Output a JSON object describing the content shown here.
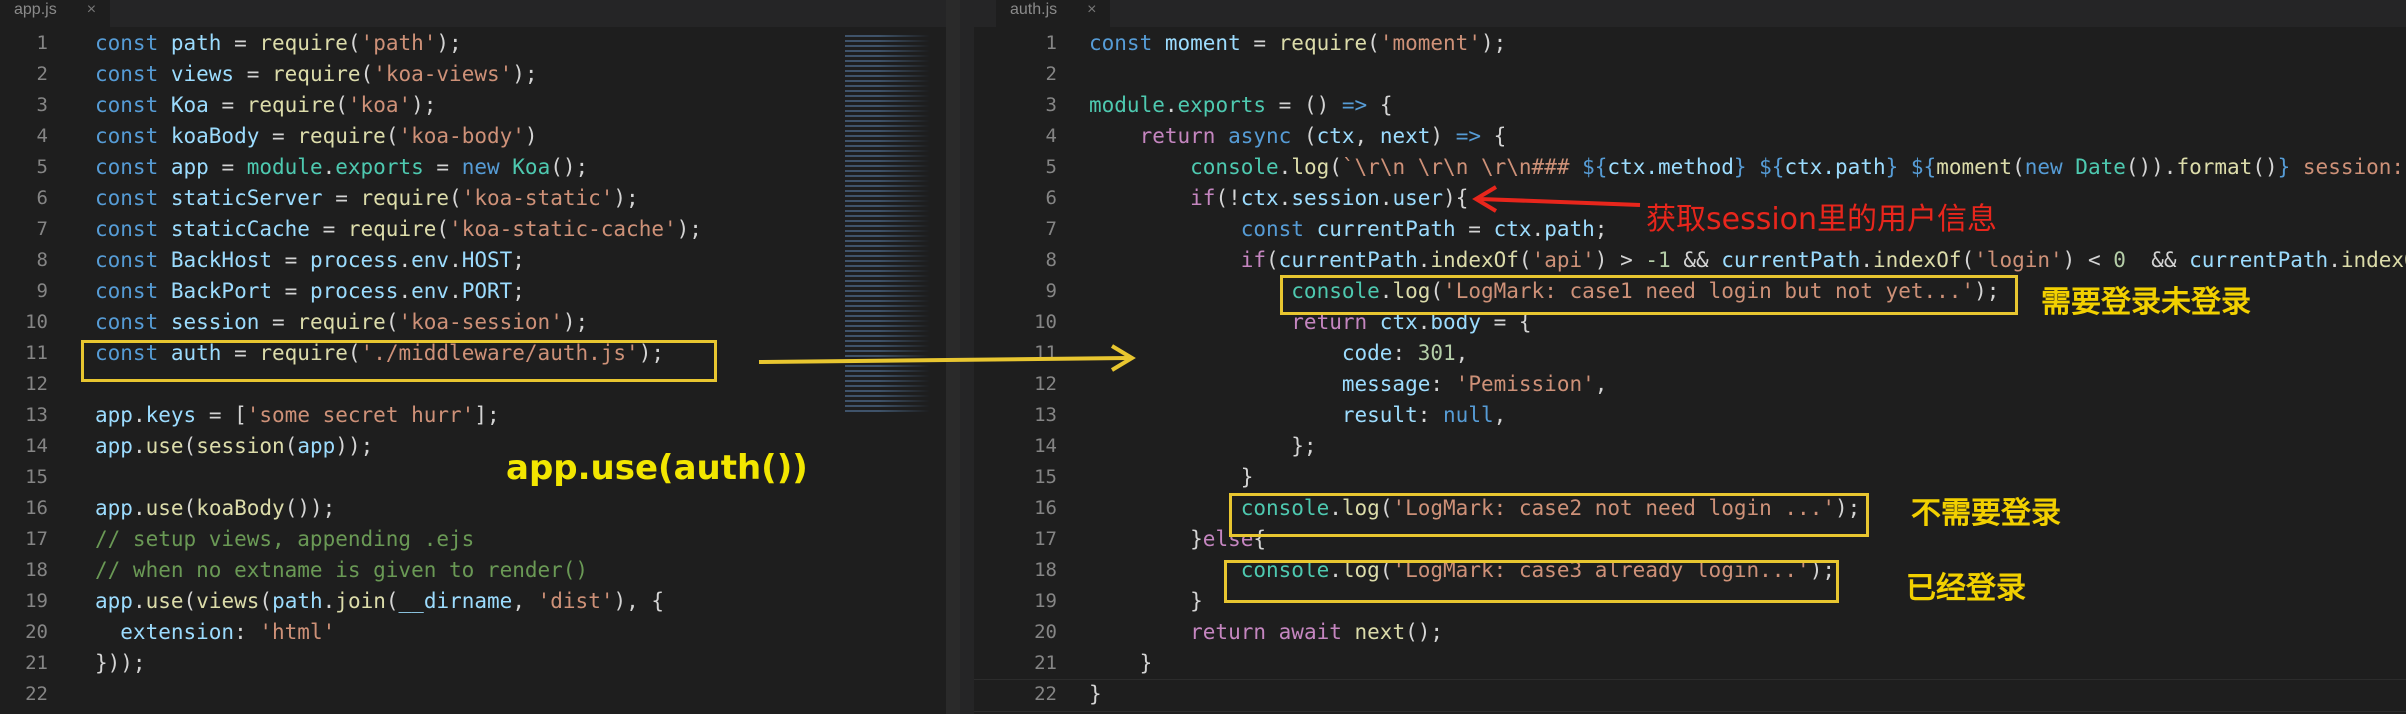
{
  "left": {
    "tab_label": "app.js",
    "tab_close": "×",
    "lines": [
      [
        [
          "const ",
          "k"
        ],
        [
          "path",
          "v"
        ],
        [
          " = ",
          "o"
        ],
        [
          "require",
          "f"
        ],
        [
          "(",
          "o"
        ],
        [
          "'path'",
          "s"
        ],
        [
          ");",
          "o"
        ]
      ],
      [
        [
          "const ",
          "k"
        ],
        [
          "views",
          "v"
        ],
        [
          " = ",
          "o"
        ],
        [
          "require",
          "f"
        ],
        [
          "(",
          "o"
        ],
        [
          "'koa-views'",
          "s"
        ],
        [
          ");",
          "o"
        ]
      ],
      [
        [
          "const ",
          "k"
        ],
        [
          "Koa",
          "v"
        ],
        [
          " = ",
          "o"
        ],
        [
          "require",
          "f"
        ],
        [
          "(",
          "o"
        ],
        [
          "'koa'",
          "s"
        ],
        [
          ");",
          "o"
        ]
      ],
      [
        [
          "const ",
          "k"
        ],
        [
          "koaBody",
          "v"
        ],
        [
          " = ",
          "o"
        ],
        [
          "require",
          "f"
        ],
        [
          "(",
          "o"
        ],
        [
          "'koa-body'",
          "s"
        ],
        [
          ")",
          "o"
        ]
      ],
      [
        [
          "const ",
          "k"
        ],
        [
          "app",
          "v"
        ],
        [
          " = ",
          "o"
        ],
        [
          "module",
          "m"
        ],
        [
          ".",
          "o"
        ],
        [
          "exports",
          "m"
        ],
        [
          " = ",
          "o"
        ],
        [
          "new ",
          "k"
        ],
        [
          "Koa",
          "m"
        ],
        [
          "();",
          "o"
        ]
      ],
      [
        [
          "const ",
          "k"
        ],
        [
          "staticServer",
          "v"
        ],
        [
          " = ",
          "o"
        ],
        [
          "require",
          "f"
        ],
        [
          "(",
          "o"
        ],
        [
          "'koa-static'",
          "s"
        ],
        [
          ");",
          "o"
        ]
      ],
      [
        [
          "const ",
          "k"
        ],
        [
          "staticCache",
          "v"
        ],
        [
          " = ",
          "o"
        ],
        [
          "require",
          "f"
        ],
        [
          "(",
          "o"
        ],
        [
          "'koa-static-cache'",
          "s"
        ],
        [
          ");",
          "o"
        ]
      ],
      [
        [
          "const ",
          "k"
        ],
        [
          "BackHost",
          "v"
        ],
        [
          " = ",
          "o"
        ],
        [
          "process",
          "v"
        ],
        [
          ".",
          "o"
        ],
        [
          "env",
          "v"
        ],
        [
          ".",
          "o"
        ],
        [
          "HOST",
          "v"
        ],
        [
          ";",
          "o"
        ]
      ],
      [
        [
          "const ",
          "k"
        ],
        [
          "BackPort",
          "v"
        ],
        [
          " = ",
          "o"
        ],
        [
          "process",
          "v"
        ],
        [
          ".",
          "o"
        ],
        [
          "env",
          "v"
        ],
        [
          ".",
          "o"
        ],
        [
          "PORT",
          "v"
        ],
        [
          ";",
          "o"
        ]
      ],
      [
        [
          "const ",
          "k"
        ],
        [
          "session",
          "v"
        ],
        [
          " = ",
          "o"
        ],
        [
          "require",
          "f"
        ],
        [
          "(",
          "o"
        ],
        [
          "'koa-session'",
          "s"
        ],
        [
          ");",
          "o"
        ]
      ],
      [
        [
          "const ",
          "k"
        ],
        [
          "auth",
          "v"
        ],
        [
          " = ",
          "o"
        ],
        [
          "require",
          "f"
        ],
        [
          "(",
          "o"
        ],
        [
          "'./middleware/auth.js'",
          "s"
        ],
        [
          ");",
          "o"
        ]
      ],
      [],
      [
        [
          "app",
          "v"
        ],
        [
          ".",
          "o"
        ],
        [
          "keys",
          "v"
        ],
        [
          " = [",
          "o"
        ],
        [
          "'some secret hurr'",
          "s"
        ],
        [
          "];",
          "o"
        ]
      ],
      [
        [
          "app",
          "v"
        ],
        [
          ".",
          "o"
        ],
        [
          "use",
          "f"
        ],
        [
          "(",
          "o"
        ],
        [
          "session",
          "f"
        ],
        [
          "(",
          "o"
        ],
        [
          "app",
          "v"
        ],
        [
          "));",
          "o"
        ]
      ],
      [],
      [
        [
          "app",
          "v"
        ],
        [
          ".",
          "o"
        ],
        [
          "use",
          "f"
        ],
        [
          "(",
          "o"
        ],
        [
          "koaBody",
          "f"
        ],
        [
          "());",
          "o"
        ]
      ],
      [
        [
          "// setup views, appending .ejs",
          "c"
        ]
      ],
      [
        [
          "// when no extname is given to render()",
          "c"
        ]
      ],
      [
        [
          "app",
          "v"
        ],
        [
          ".",
          "o"
        ],
        [
          "use",
          "f"
        ],
        [
          "(",
          "o"
        ],
        [
          "views",
          "f"
        ],
        [
          "(",
          "o"
        ],
        [
          "path",
          "v"
        ],
        [
          ".",
          "o"
        ],
        [
          "join",
          "f"
        ],
        [
          "(",
          "o"
        ],
        [
          "__dirname",
          "v"
        ],
        [
          ", ",
          "o"
        ],
        [
          "'dist'",
          "s"
        ],
        [
          "), {",
          "o"
        ]
      ],
      [
        [
          "  extension",
          "v"
        ],
        [
          ": ",
          "o"
        ],
        [
          "'html'",
          "s"
        ]
      ],
      [
        [
          "}));",
          "o"
        ]
      ],
      []
    ]
  },
  "right": {
    "tab_label": "auth.js",
    "tab_close": "×",
    "lines": [
      [
        [
          "const ",
          "k"
        ],
        [
          "moment",
          "v"
        ],
        [
          " = ",
          "o"
        ],
        [
          "require",
          "f"
        ],
        [
          "(",
          "o"
        ],
        [
          "'moment'",
          "s"
        ],
        [
          ");",
          "o"
        ]
      ],
      [],
      [
        [
          "module",
          "m"
        ],
        [
          ".",
          "o"
        ],
        [
          "exports",
          "m"
        ],
        [
          " = () ",
          "o"
        ],
        [
          "=>",
          "k"
        ],
        [
          " {",
          "o"
        ]
      ],
      [
        [
          "    return ",
          "p"
        ],
        [
          "async ",
          "k"
        ],
        [
          "(",
          "o"
        ],
        [
          "ctx",
          "v"
        ],
        [
          ", ",
          "o"
        ],
        [
          "next",
          "v"
        ],
        [
          ") ",
          "o"
        ],
        [
          "=>",
          "k"
        ],
        [
          " {",
          "o"
        ]
      ],
      [
        [
          "        console",
          "m"
        ],
        [
          ".",
          "o"
        ],
        [
          "log",
          "f"
        ],
        [
          "(",
          "o"
        ],
        [
          "`\\r\\n \\r\\n \\r\\n### ",
          "s"
        ],
        [
          "${",
          "k"
        ],
        [
          "ctx.method",
          "v"
        ],
        [
          "} ",
          "k"
        ],
        [
          "${",
          "k"
        ],
        [
          "ctx.path",
          "v"
        ],
        [
          "} ",
          "k"
        ],
        [
          "${",
          "k"
        ],
        [
          "moment",
          "f"
        ],
        [
          "(",
          "o"
        ],
        [
          "new ",
          "k"
        ],
        [
          "Date",
          "m"
        ],
        [
          "()).",
          "o"
        ],
        [
          "format",
          "f"
        ],
        [
          "()",
          "o"
        ],
        [
          "} ",
          "k"
        ],
        [
          "session:",
          "s"
        ]
      ],
      [
        [
          "        if",
          "p"
        ],
        [
          "(!",
          "o"
        ],
        [
          "ctx",
          "v"
        ],
        [
          ".",
          "o"
        ],
        [
          "session",
          "v"
        ],
        [
          ".",
          "o"
        ],
        [
          "user",
          "v"
        ],
        [
          "){",
          "o"
        ]
      ],
      [
        [
          "            const ",
          "k"
        ],
        [
          "currentPath",
          "v"
        ],
        [
          " = ",
          "o"
        ],
        [
          "ctx",
          "v"
        ],
        [
          ".",
          "o"
        ],
        [
          "path",
          "v"
        ],
        [
          ";",
          "o"
        ]
      ],
      [
        [
          "            if",
          "p"
        ],
        [
          "(",
          "o"
        ],
        [
          "currentPath",
          "v"
        ],
        [
          ".",
          "o"
        ],
        [
          "indexOf",
          "f"
        ],
        [
          "(",
          "o"
        ],
        [
          "'api'",
          "s"
        ],
        [
          ") > ",
          "o"
        ],
        [
          "-1",
          "n"
        ],
        [
          " && ",
          "o"
        ],
        [
          "currentPath",
          "v"
        ],
        [
          ".",
          "o"
        ],
        [
          "indexOf",
          "f"
        ],
        [
          "(",
          "o"
        ],
        [
          "'login'",
          "s"
        ],
        [
          ") < ",
          "o"
        ],
        [
          "0",
          "n"
        ],
        [
          "  && ",
          "o"
        ],
        [
          "currentPath",
          "v"
        ],
        [
          ".",
          "o"
        ],
        [
          "indexOf",
          "f"
        ]
      ],
      [
        [
          "                console",
          "m"
        ],
        [
          ".",
          "o"
        ],
        [
          "log",
          "f"
        ],
        [
          "(",
          "o"
        ],
        [
          "'LogMark: case1 need login but not yet...'",
          "s"
        ],
        [
          ");",
          "o"
        ]
      ],
      [
        [
          "                return ",
          "p"
        ],
        [
          "ctx",
          "v"
        ],
        [
          ".",
          "o"
        ],
        [
          "body",
          "v"
        ],
        [
          " = {",
          "o"
        ]
      ],
      [
        [
          "                    code",
          "v"
        ],
        [
          ": ",
          "o"
        ],
        [
          "301",
          "n"
        ],
        [
          ",",
          "o"
        ]
      ],
      [
        [
          "                    message",
          "v"
        ],
        [
          ": ",
          "o"
        ],
        [
          "'Pemission'",
          "s"
        ],
        [
          ",",
          "o"
        ]
      ],
      [
        [
          "                    result",
          "v"
        ],
        [
          ": ",
          "o"
        ],
        [
          "null",
          "k"
        ],
        [
          ",",
          "o"
        ]
      ],
      [
        [
          "                };",
          "o"
        ]
      ],
      [
        [
          "            }",
          "o"
        ]
      ],
      [
        [
          "            console",
          "m"
        ],
        [
          ".",
          "o"
        ],
        [
          "log",
          "f"
        ],
        [
          "(",
          "o"
        ],
        [
          "'LogMark: case2 not need login ...'",
          "s"
        ],
        [
          ");",
          "o"
        ]
      ],
      [
        [
          "        }",
          "o"
        ],
        [
          "else",
          "p"
        ],
        [
          "{",
          "o"
        ]
      ],
      [
        [
          "            console",
          "m"
        ],
        [
          ".",
          "o"
        ],
        [
          "log",
          "f"
        ],
        [
          "(",
          "o"
        ],
        [
          "'LogMark: case3 already login...'",
          "s"
        ],
        [
          ");",
          "o"
        ]
      ],
      [
        [
          "        }",
          "o"
        ]
      ],
      [
        [
          "        return ",
          "p"
        ],
        [
          "await ",
          "p"
        ],
        [
          "next",
          "f"
        ],
        [
          "();",
          "o"
        ]
      ],
      [
        [
          "    }",
          "o"
        ]
      ],
      [
        [
          "}",
          "o"
        ]
      ]
    ]
  },
  "annotations": {
    "left_label": "app.use(auth())",
    "session_note": "获取session里的用户信息",
    "case1_note": "需要登录未登录",
    "case2_note": "不需要登录",
    "case3_note": "已经登录"
  },
  "colors": {
    "highlight_box": "#e8c630",
    "label_yellow": "#f2e600",
    "red": "#e8261c"
  }
}
